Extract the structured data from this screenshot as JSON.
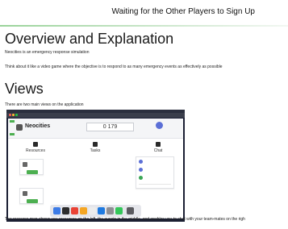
{
  "header": {
    "title": "Waiting for the Other Players to Sign Up"
  },
  "overview": {
    "heading": "Overview and Explanation",
    "line1": "Neocities is an emergency response simulation",
    "line2": "Think about it like a video game where the objective is to respond to as many emergency events as effectively as possible"
  },
  "views": {
    "heading": "Views",
    "intro": "There are two main views on the application",
    "caption": "The resource map shows you resources on the left, the events in the middle, and enables you to chat with your team-mates on the righ"
  },
  "screenshot": {
    "app_name": "Neocities",
    "score": "0 179",
    "columns": [
      "Resources",
      "Tasks",
      "Chat"
    ],
    "colors": {
      "accent_green": "#4caf50",
      "chat_purple": "#5b6fd6",
      "chat_green": "#3aa655"
    }
  }
}
